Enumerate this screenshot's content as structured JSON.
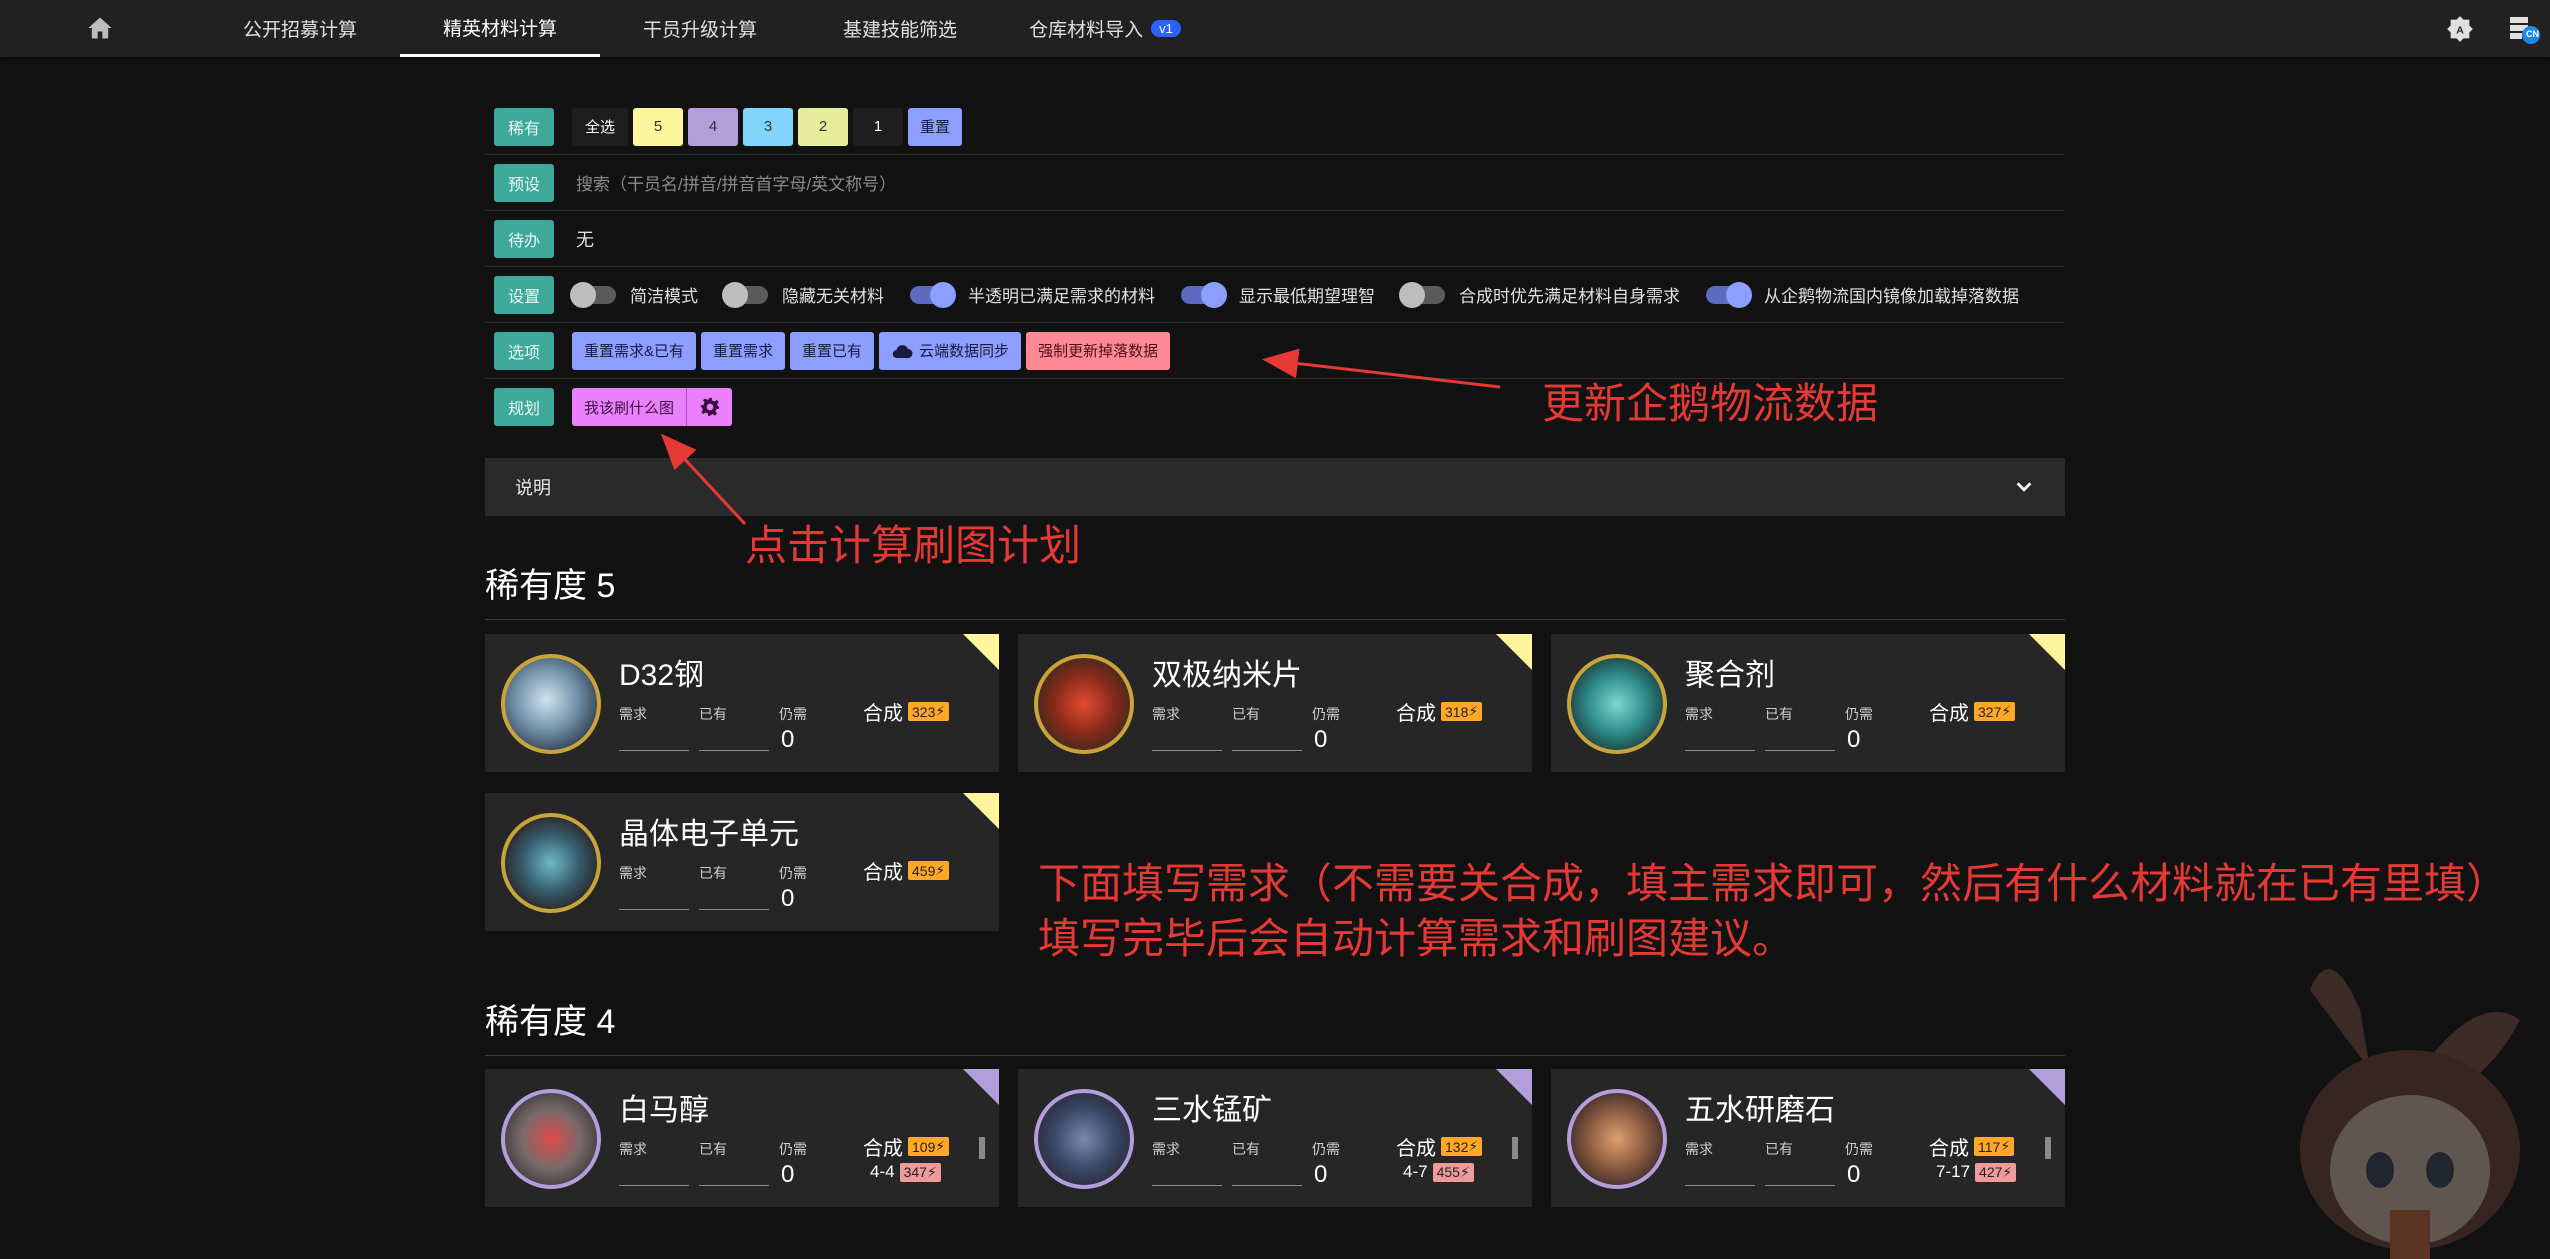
{
  "nav": {
    "tabs": [
      "公开招募计算",
      "精英材料计算",
      "干员升级计算",
      "基建技能筛选",
      "仓库材料导入"
    ],
    "active_tab": "精英材料计算",
    "import_badge": "v1",
    "lang_badge": "CN"
  },
  "controls": {
    "rarity": {
      "label": "稀有",
      "select_all": "全选",
      "levels": [
        "5",
        "4",
        "3",
        "2",
        "1"
      ],
      "reset": "重置"
    },
    "preset": {
      "label": "预设",
      "placeholder": "搜索（干员名/拼音/拼音首字母/英文称号）"
    },
    "todo": {
      "label": "待办",
      "value": "无"
    },
    "settings": {
      "label": "设置",
      "switches": [
        {
          "label": "简洁模式",
          "on": false
        },
        {
          "label": "隐藏无关材料",
          "on": false
        },
        {
          "label": "半透明已满足需求的材料",
          "on": true
        },
        {
          "label": "显示最低期望理智",
          "on": true
        },
        {
          "label": "合成时优先满足材料自身需求",
          "on": false
        },
        {
          "label": "从企鹅物流国内镜像加载掉落数据",
          "on": true
        }
      ]
    },
    "options": {
      "label": "选项",
      "buttons": [
        "重置需求&已有",
        "重置需求",
        "重置已有",
        "云端数据同步",
        "强制更新掉落数据"
      ]
    },
    "plan": {
      "label": "规划",
      "button": "我该刷什么图"
    }
  },
  "explain": {
    "label": "说明"
  },
  "annotations": {
    "update": "更新企鹅物流数据",
    "plan_hint": "点击计算刷图计划",
    "fill_line1": "下面填写需求（不需要关合成，填主需求即可，然后有什么材料就在已有里填）",
    "fill_line2": "填写完毕后会自动计算需求和刷图建议。"
  },
  "field_labels": {
    "need": "需求",
    "have": "已有",
    "still": "仍需",
    "craft": "合成"
  },
  "sections": [
    {
      "title": "稀有度 5",
      "items": [
        {
          "name": "D32钢",
          "still": "0",
          "craft_cost": "323"
        },
        {
          "name": "双极纳米片",
          "still": "0",
          "craft_cost": "318"
        },
        {
          "name": "聚合剂",
          "still": "0",
          "craft_cost": "327"
        },
        {
          "name": "晶体电子单元",
          "still": "0",
          "craft_cost": "459"
        }
      ]
    },
    {
      "title": "稀有度 4",
      "items": [
        {
          "name": "白马醇",
          "still": "0",
          "craft_cost": "109",
          "stage": "4-4",
          "stage_cost": "347"
        },
        {
          "name": "三水锰矿",
          "still": "0",
          "craft_cost": "132",
          "stage": "4-7",
          "stage_cost": "455"
        },
        {
          "name": "五水研磨石",
          "still": "0",
          "craft_cost": "117",
          "stage": "7-17",
          "stage_cost": "427"
        }
      ]
    }
  ],
  "colors": {
    "tag": "#3ea99b",
    "r5": "#fff59d",
    "r4": "#b39ddb",
    "r3": "#81d4fa",
    "r2": "#e6ee9c",
    "reset": "#8c9eff",
    "plan_button": "#ea80fc",
    "force_update": "#ff8a95",
    "annotation": "#e53935"
  }
}
